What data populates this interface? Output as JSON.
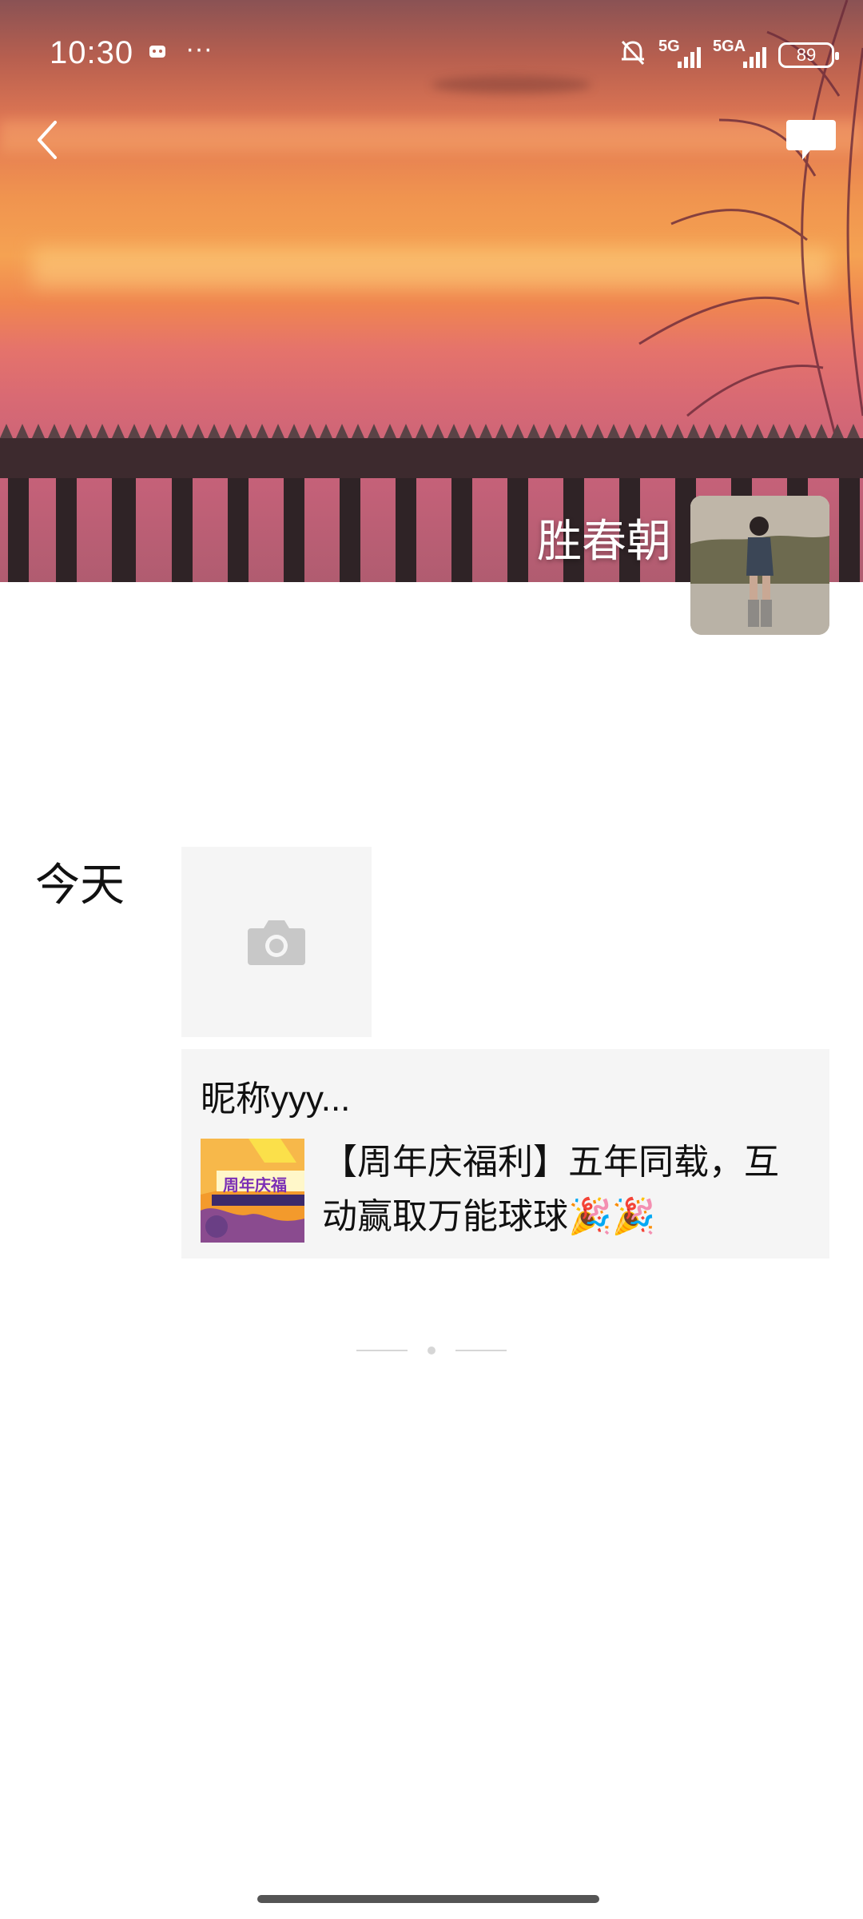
{
  "status_bar": {
    "time": "10:30",
    "more_dots": "···",
    "signal1_label": "5G",
    "signal2_label": "5GA",
    "battery": "89"
  },
  "profile": {
    "name": "胜春朝"
  },
  "feed": {
    "date_label": "今天",
    "share": {
      "author": "昵称yyy...",
      "title": "【周年庆福利】五年同载，互动赢取万能球球🎉🎉",
      "thumb_text": "周年庆福"
    }
  },
  "colors": {
    "background": "#ffffff",
    "card_bg": "#f5f5f5",
    "camera_icon": "#c8c8c8",
    "text": "#111111"
  },
  "icons": [
    "back-arrow-icon",
    "message-icon",
    "camera-icon",
    "mute-bell-icon",
    "signal-icon",
    "battery-icon"
  ]
}
